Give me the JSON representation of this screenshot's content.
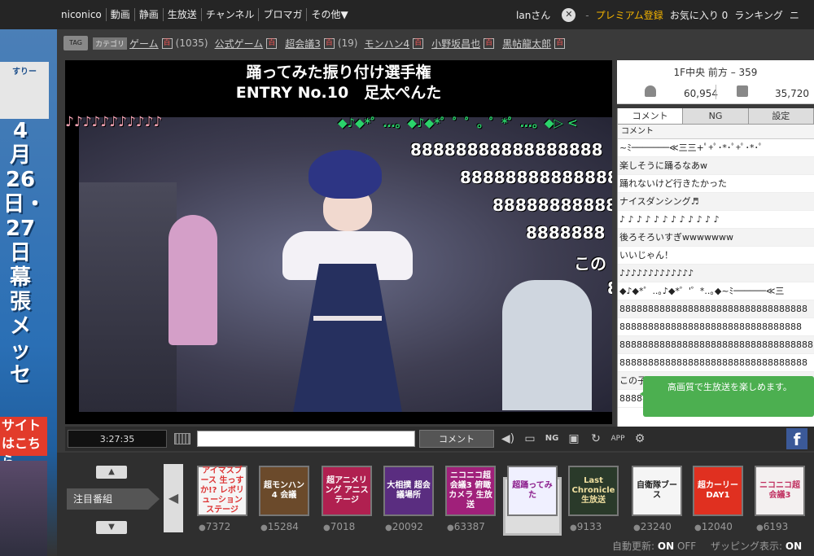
{
  "topbar": {
    "nav": [
      "niconico",
      "動画",
      "静画",
      "生放送",
      "チャンネル",
      "ブロマガ",
      "その他▼"
    ],
    "user": "lanさん",
    "premium": "プレミアム登録",
    "favorites": "お気に入り 0",
    "ranking": "ランキング",
    "more": "ニ"
  },
  "left_banner": {
    "logo": "すりー",
    "dates": "4月26日・27日幕張メッセ",
    "site_link": "サイトはこちら"
  },
  "tags": [
    {
      "cat": "カテゴリ",
      "name": "ゲーム",
      "count": "(1035)"
    },
    {
      "name": "公式ゲーム"
    },
    {
      "name": "超会議3",
      "count": "(19)"
    },
    {
      "name": "モンハン4"
    },
    {
      "name": "小野坂昌也"
    },
    {
      "name": "黒帖龍太郎"
    }
  ],
  "tag_icon_label": "TAG",
  "player": {
    "title_line1": "踊ってみた振り付け選手権",
    "title_line2": "ENTRY No.10　足太ぺんた"
  },
  "overlay_comments": [
    "♪♪♪♪♪♪♪♪♪♪♪",
    "◆♪◆*゜…。◆♪◆*゜゜゜。゜*゜…。◆▷ <",
    "88888888888888888",
    "8888888888888888",
    "888888888888",
    "8888888",
    "この",
    "8"
  ],
  "stats": {
    "room": "1F中央 前方 – 359",
    "viewers": "60,954",
    "comments": "35,720"
  },
  "comment_panel": {
    "tabs": [
      "コメント",
      "NG",
      "設定"
    ],
    "header": "コメント",
    "rows": [
      "~ﾐ───────≪三三+ﾟ+ﾟ･*･ﾟ+ﾟ･*･ﾟ",
      "楽しそうに踊るなあw",
      "踊れないけど行きたかった",
      "ナイスダンシング♬",
      "♪ ♪ ♪ ♪ ♪ ♪ ♪ ♪ ♪ ♪ ♪ ♪",
      "後ろそろいすぎwwwwwww",
      "いいじゃん！",
      "♪♪♪♪♪♪♪♪♪♪♪♪♪",
      "◆♪◆*゜..｡♪◆*゜'゜*..｡◆~ﾐ──────≪三",
      "888888888888888888888888888888888",
      "88888888888888888888888888888888",
      "8888888888888888888888888888888888",
      "888888888888888888888888888888888",
      "この子ほんとにかわいい",
      "8888888888"
    ]
  },
  "toast": "高画質で生放送を楽しめます。",
  "controls": {
    "time": "3:27:35",
    "comment_button": "コメント",
    "input_value": ""
  },
  "tray": {
    "label": "注目番組",
    "items": [
      {
        "title": "アイマスブース 生っすか!? レボリューション ステージ",
        "count": "7372",
        "bg": "#f5f5f5",
        "fg": "#d33"
      },
      {
        "title": "超モンハン4 会議",
        "count": "15284",
        "bg": "#6b4a2b",
        "fg": "#fff"
      },
      {
        "title": "超アニメリング アニステージ",
        "count": "7018",
        "bg": "#b02050",
        "fg": "#fff"
      },
      {
        "title": "大相撲 超会議場所",
        "count": "20092",
        "bg": "#5a2d80",
        "fg": "#fff"
      },
      {
        "title": "ニコニコ超会議3 俯瞰カメラ 生放送",
        "count": "63387",
        "bg": "#a0207a",
        "fg": "#fff"
      },
      {
        "title": "超踊ってみた",
        "count": "",
        "bg": "#f0f0ff",
        "fg": "#8a1a8a"
      },
      {
        "title": "Last Chronicle 生放送",
        "count": "9133",
        "bg": "#2a3a2a",
        "fg": "#f0e0a0"
      },
      {
        "title": "自衛隊ブース",
        "count": "23240",
        "bg": "#f5f5f5",
        "fg": "#222"
      },
      {
        "title": "超カーリー DAY1",
        "count": "12040",
        "bg": "#e03020",
        "fg": "#fff"
      },
      {
        "title": "ニコニコ超会議3",
        "count": "6193",
        "bg": "#f3f0f0",
        "fg": "#c03060"
      }
    ]
  },
  "footer": {
    "auto_update": "自動更新:",
    "on": "ON",
    "off": "OFF",
    "zapping": "ザッピング表示:",
    "zap_on": "ON"
  },
  "colors": {
    "premium": "#f4b400",
    "toast": "#4caf50",
    "facebook": "#3b5998"
  }
}
